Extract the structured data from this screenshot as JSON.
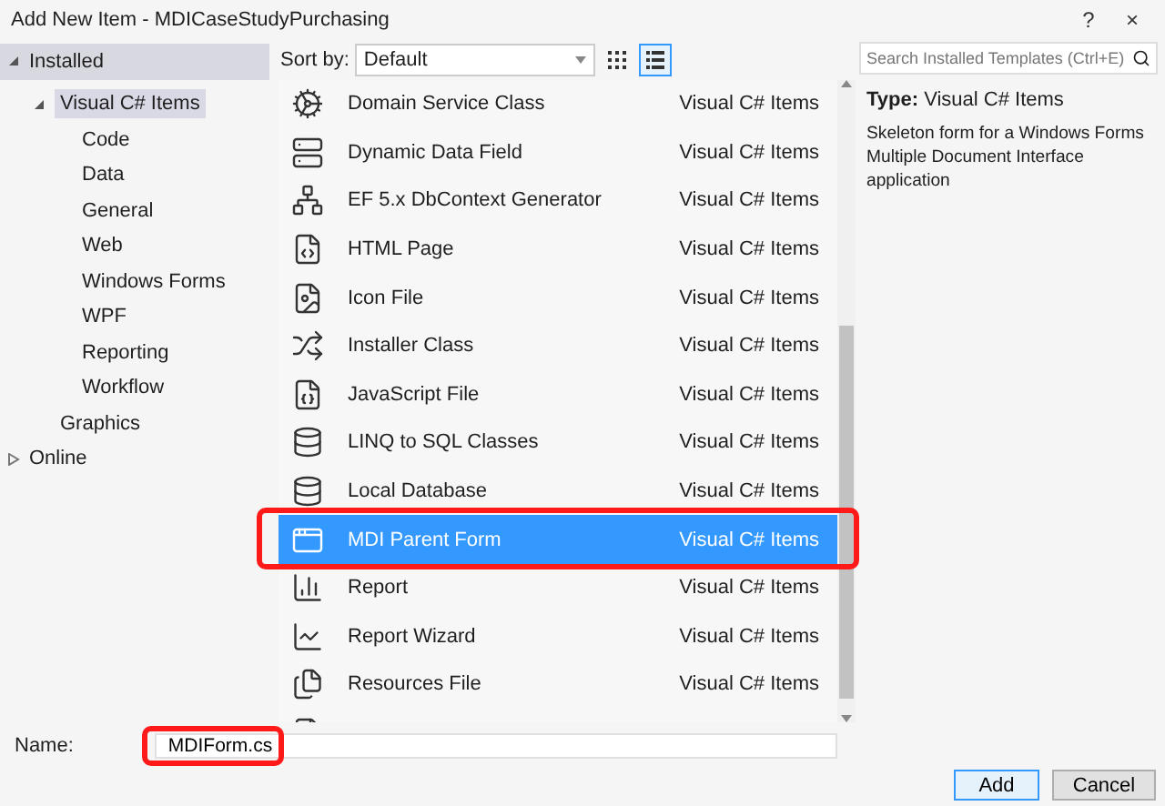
{
  "window": {
    "title": "Add New Item - MDICaseStudyPurchasing",
    "help": "?",
    "close": "×"
  },
  "sidebar": {
    "items": [
      {
        "label": "Installed",
        "expanded": true,
        "children": [
          {
            "label": "Visual C# Items",
            "expanded": true,
            "selected": true,
            "children": [
              {
                "label": "Code",
                "selected": false
              },
              {
                "label": "Data",
                "selected": false
              },
              {
                "label": "General",
                "selected": false
              },
              {
                "label": "Web",
                "selected": false
              },
              {
                "label": "Windows Forms",
                "selected": false
              },
              {
                "label": "WPF",
                "selected": false
              },
              {
                "label": "Reporting",
                "selected": false
              },
              {
                "label": "Workflow",
                "selected": false
              }
            ]
          },
          {
            "label": "Graphics",
            "selected": false
          }
        ]
      },
      {
        "label": "Online",
        "expanded": false
      }
    ]
  },
  "toolbar": {
    "sort_label": "Sort by:",
    "sort_value": "Default",
    "view_buttons": [
      {
        "kind": "grid",
        "selected": false
      },
      {
        "kind": "list",
        "selected": true
      }
    ]
  },
  "search": {
    "placeholder": "Search Installed Templates (Ctrl+E)"
  },
  "templates": [
    {
      "name": "Domain Service Class",
      "category": "Visual C# Items",
      "selected": false
    },
    {
      "name": "Dynamic Data Field",
      "category": "Visual C# Items",
      "selected": false
    },
    {
      "name": "EF 5.x DbContext Generator",
      "category": "Visual C# Items",
      "selected": false
    },
    {
      "name": "HTML Page",
      "category": "Visual C# Items",
      "selected": false
    },
    {
      "name": "Icon File",
      "category": "Visual C# Items",
      "selected": false
    },
    {
      "name": "Installer Class",
      "category": "Visual C# Items",
      "selected": false
    },
    {
      "name": "JavaScript File",
      "category": "Visual C# Items",
      "selected": false
    },
    {
      "name": "LINQ to SQL Classes",
      "category": "Visual C# Items",
      "selected": false
    },
    {
      "name": "Local Database",
      "category": "Visual C# Items",
      "selected": false
    },
    {
      "name": "MDI Parent Form",
      "category": "Visual C# Items",
      "selected": true
    },
    {
      "name": "Report",
      "category": "Visual C# Items",
      "selected": false
    },
    {
      "name": "Report Wizard",
      "category": "Visual C# Items",
      "selected": false
    },
    {
      "name": "Resources File",
      "category": "Visual C# Items",
      "selected": false
    }
  ],
  "details": {
    "type_label": "Type:",
    "type_value": "Visual C# Items",
    "description": "Skeleton form for a Windows Forms Multiple Document Interface application"
  },
  "name_field": {
    "label": "Name:",
    "value": "MDIForm.cs"
  },
  "buttons": [
    {
      "label": "Add",
      "default": true
    },
    {
      "label": "Cancel",
      "default": false
    }
  ]
}
